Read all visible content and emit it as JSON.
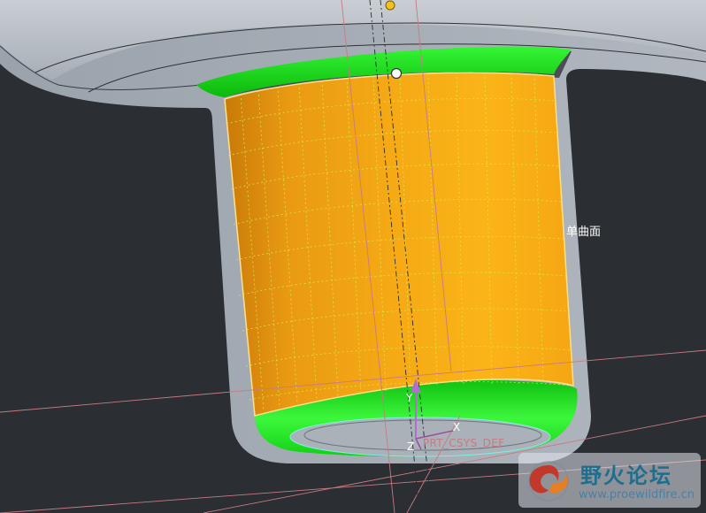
{
  "viewport": {
    "background": "#2b2e33",
    "shell_color": "#a6adb6",
    "selected_surface_color": "#f3a711",
    "fillet_color": "#12e012",
    "datum_line_color": "#c77b82"
  },
  "annotations": {
    "surface_label": "单曲面"
  },
  "coordinate_system": {
    "name": "PRT_CSYS_DEF",
    "axis_x": "X",
    "axis_y": "Y",
    "axis_z": "Z"
  },
  "watermark": {
    "title": "野火论坛",
    "url": "www.proewildfire.cn"
  },
  "icons": {
    "logo": "wildfire-logo-icon"
  }
}
